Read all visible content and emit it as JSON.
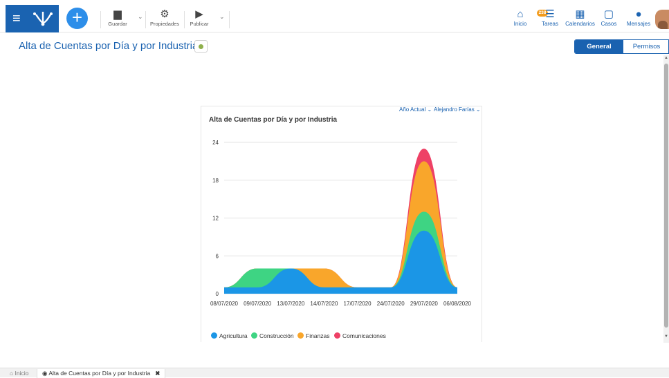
{
  "toolbar": {
    "save_label": "Guardar",
    "properties_label": "Propiedades",
    "publish_label": "Publicar"
  },
  "nav": {
    "home": "Inicio",
    "tasks": "Tareas",
    "tasks_badge": "238",
    "calendars": "Calendarios",
    "cases": "Casos",
    "messages": "Mensajes"
  },
  "page": {
    "title": "Alta de Cuentas por Día y por Industria",
    "tabs": [
      "General",
      "Permisos"
    ]
  },
  "filters": {
    "period": "Año Actual",
    "user": "Alejandro Farías"
  },
  "chart_data": {
    "type": "area",
    "stacked": true,
    "title": "Alta de Cuentas por Día y por Industria",
    "x": [
      "08/07/2020",
      "09/07/2020",
      "13/07/2020",
      "14/07/2020",
      "17/07/2020",
      "24/07/2020",
      "29/07/2020",
      "06/08/2020"
    ],
    "series": [
      {
        "name": "Agricultura",
        "color": "#1b96e6",
        "values": [
          1,
          1,
          4,
          1,
          1,
          1,
          10,
          1
        ]
      },
      {
        "name": "Construcción",
        "color": "#3ed483",
        "values": [
          0,
          3,
          0,
          0,
          0,
          0,
          3,
          0
        ]
      },
      {
        "name": "Finanzas",
        "color": "#f9a62b",
        "values": [
          0,
          0,
          0,
          3,
          0,
          0,
          8,
          0
        ]
      },
      {
        "name": "Comunicaciones",
        "color": "#ee4166",
        "values": [
          0,
          0,
          0,
          0,
          0,
          0,
          2,
          0
        ]
      }
    ],
    "yticks": [
      "0",
      "6",
      "12",
      "18",
      "24"
    ],
    "ylim": [
      0,
      24
    ],
    "grid": true,
    "legend": "bottom"
  },
  "bottom_tabs": {
    "home": "Inicio",
    "current": "Alta de Cuentas por Día y por Industria",
    "close": "✖"
  },
  "colors": {
    "primary": "#1a62b0",
    "accent": "#2d8ee9",
    "badge": "#f29b1d"
  }
}
